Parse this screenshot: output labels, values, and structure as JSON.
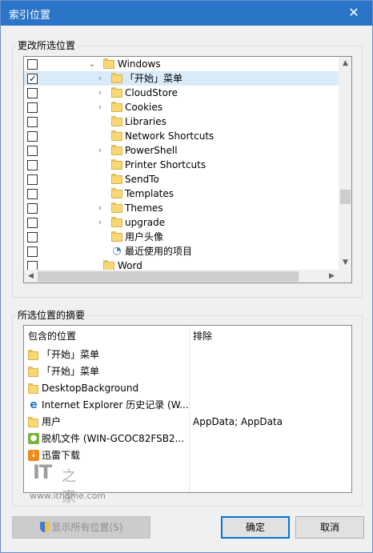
{
  "window": {
    "title": "索引位置",
    "close_glyph": "✕"
  },
  "change_group": {
    "title": "更改所选位置"
  },
  "tree": {
    "rows": [
      {
        "label": "Windows",
        "checked": false,
        "expander": "open",
        "icon": "folder-icon",
        "indent": 1
      },
      {
        "label": "「开始」菜单",
        "checked": true,
        "expander": "closed",
        "icon": "folder-icon",
        "indent": 2,
        "selected": true
      },
      {
        "label": "CloudStore",
        "checked": false,
        "expander": "closed",
        "icon": "folder-icon",
        "indent": 2
      },
      {
        "label": "Cookies",
        "checked": false,
        "expander": "closed",
        "icon": "folder-icon",
        "indent": 2
      },
      {
        "label": "Libraries",
        "checked": false,
        "expander": "none",
        "icon": "folder-icon",
        "indent": 2
      },
      {
        "label": "Network Shortcuts",
        "checked": false,
        "expander": "none",
        "icon": "folder-icon",
        "indent": 2
      },
      {
        "label": "PowerShell",
        "checked": false,
        "expander": "closed",
        "icon": "folder-icon",
        "indent": 2
      },
      {
        "label": "Printer Shortcuts",
        "checked": false,
        "expander": "none",
        "icon": "folder-icon",
        "indent": 2
      },
      {
        "label": "SendTo",
        "checked": false,
        "expander": "none",
        "icon": "folder-icon",
        "indent": 2
      },
      {
        "label": "Templates",
        "checked": false,
        "expander": "none",
        "icon": "folder-icon",
        "indent": 2
      },
      {
        "label": "Themes",
        "checked": false,
        "expander": "closed",
        "icon": "folder-icon",
        "indent": 2
      },
      {
        "label": "upgrade",
        "checked": false,
        "expander": "closed",
        "icon": "folder-icon",
        "indent": 2
      },
      {
        "label": "用户头像",
        "checked": false,
        "expander": "none",
        "icon": "folder-icon",
        "indent": 2
      },
      {
        "label": "最近使用的项目",
        "checked": false,
        "expander": "none",
        "icon": "recent-items-icon",
        "indent": 2
      },
      {
        "label": "Word",
        "checked": false,
        "expander": "none",
        "icon": "folder-icon",
        "indent": 1
      }
    ],
    "check_glyph": "✓",
    "chevron_open": "⌄",
    "chevron_closed": "›",
    "scroll": {
      "up": "▲",
      "down": "▼",
      "left": "◀",
      "right": "▶"
    }
  },
  "summary_group": {
    "title": "所选位置的摘要",
    "col_included": "包含的位置",
    "col_excluded": "排除",
    "rows": [
      {
        "name": "「开始」菜单",
        "icon": "folder-icon",
        "excluded": ""
      },
      {
        "name": "「开始」菜单",
        "icon": "folder-icon",
        "excluded": ""
      },
      {
        "name": "DesktopBackground",
        "icon": "folder-icon",
        "excluded": ""
      },
      {
        "name": "Internet Explorer 历史记录 (W...",
        "icon": "ie-icon",
        "excluded": ""
      },
      {
        "name": "用户",
        "icon": "folder-icon",
        "excluded": "AppData; AppData"
      },
      {
        "name": "脱机文件 (WIN-GCOC82FSB2...",
        "icon": "offline-files-icon",
        "excluded": ""
      },
      {
        "name": "迅雷下载",
        "icon": "xunlei-icon",
        "excluded": ""
      }
    ]
  },
  "watermark": {
    "logo": "IT",
    "sub": "之家",
    "url": "www.ithome.com"
  },
  "buttons": {
    "show_all": "显示所有位置(S)",
    "ok": "确定",
    "cancel": "取消"
  },
  "colors": {
    "titlebar": "#2b75c9",
    "selection": "#d9ebf9",
    "default_button_border": "#0078d7"
  }
}
